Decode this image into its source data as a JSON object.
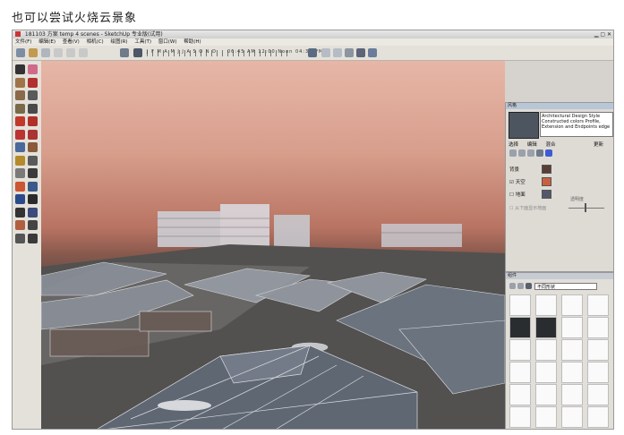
{
  "caption": "也可以尝试火烧云景象",
  "window": {
    "title": "181103 方案 temp 4 scenes - SketchUp 专业版(试用)",
    "menus": [
      "文件(F)",
      "编辑(E)",
      "查看(V)",
      "相机(C)",
      "绘图(R)",
      "工具(T)",
      "窗口(W)",
      "帮助(H)"
    ]
  },
  "toolbar": {
    "shadow_months": "J F M A M J J A S O N D",
    "time_text": "06:45  AM   12:00  Noon   04:30 PM"
  },
  "style_panel": {
    "title": "风格",
    "description": "Architectural Design Style Constructed colors Profile, Extension and Endpoints edge",
    "tabs": [
      "选择",
      "编辑",
      "混合"
    ],
    "update_label": "更新",
    "bg_label": "背景",
    "sky_label": "天空",
    "sky_checked": true,
    "ground_label": "地面",
    "ground_checked": false,
    "transparency_label": "透明度",
    "ground_from_below_label": "从下面显示地面",
    "colors": {
      "background": "#5a3e35",
      "sky": "#c8603f",
      "ground": "#52586a"
    }
  },
  "components_panel": {
    "title": "组件",
    "select_value": "不同形状"
  },
  "icons": {
    "app": "sketchup-icon",
    "tools": [
      "select-icon",
      "eraser-icon",
      "rectangle-icon",
      "line-icon",
      "circle-icon",
      "arc-icon",
      "polygon-icon",
      "freehand-icon",
      "move-icon",
      "push-pull-icon",
      "rotate-icon",
      "follow-me-icon",
      "scale-icon",
      "offset-icon",
      "tape-icon",
      "dimension-icon",
      "protractor-icon",
      "text-icon",
      "axes-icon",
      "3d-text-icon",
      "orbit-icon",
      "pan-icon",
      "zoom-icon",
      "zoom-extents-icon",
      "walk-icon",
      "look-around-icon",
      "section-icon",
      "position-camera-icon"
    ]
  }
}
